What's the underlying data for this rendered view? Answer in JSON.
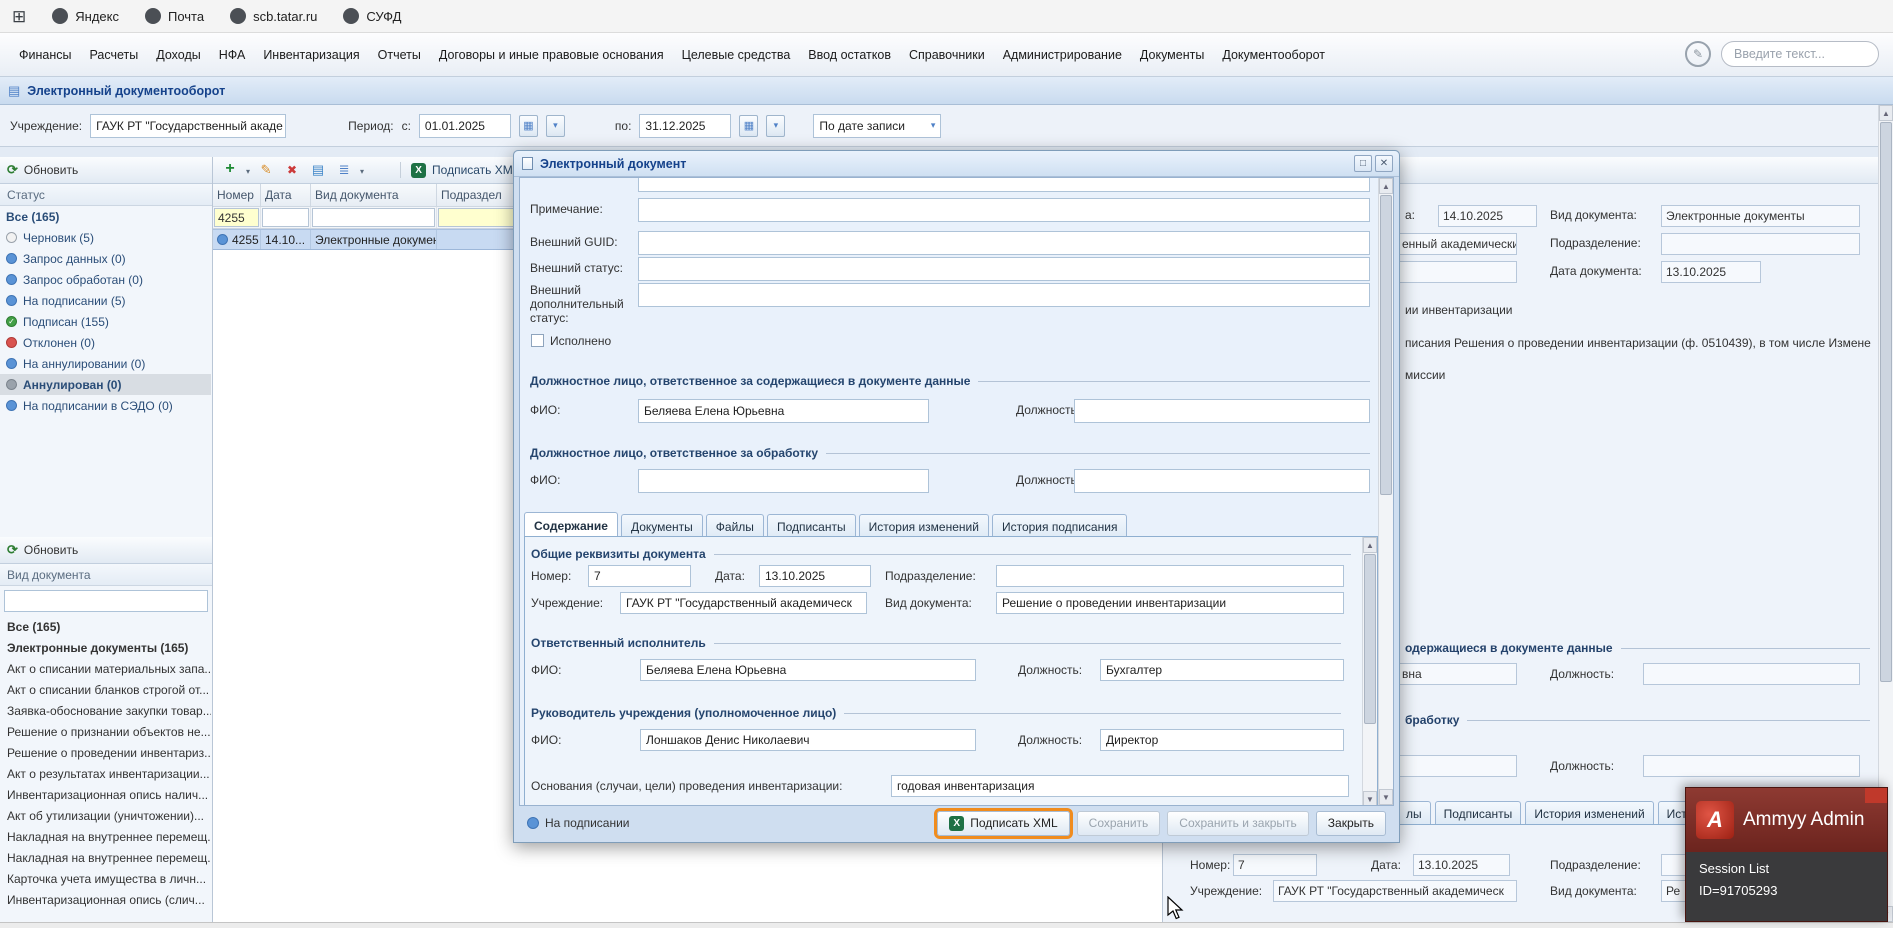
{
  "browser": {
    "bookmarks": [
      "Яндекс",
      "Почта",
      "scb.tatar.ru",
      "СУФД"
    ]
  },
  "menu": {
    "items": [
      "Финансы",
      "Расчеты",
      "Доходы",
      "НФА",
      "Инвентаризация",
      "Отчеты",
      "Договоры и иные правовые основания",
      "Целевые средства",
      "Ввод остатков",
      "Справочники",
      "Администрирование",
      "Документы",
      "Документооборот"
    ],
    "search_placeholder": "Введите текст..."
  },
  "page": {
    "title": "Электронный документооборот"
  },
  "filter_bar": {
    "institution_label": "Учреждение:",
    "institution_value": "ГАУК РТ \"Государственный акаде",
    "period_label": "Период:",
    "from_label": "с:",
    "from_value": "01.01.2025",
    "to_label": "по:",
    "to_value": "31.12.2025",
    "mode_value": "По дате записи"
  },
  "status_panel": {
    "refresh_label": "Обновить",
    "header": "Статус",
    "items": [
      {
        "label": "Все (165)",
        "cls": "b no-ic"
      },
      {
        "label": "Черновик (5)",
        "cls": "ic-draft"
      },
      {
        "label": "Запрос данных (0)",
        "cls": "ic-blue"
      },
      {
        "label": "Запрос обработан (0)",
        "cls": "ic-blue"
      },
      {
        "label": "На подписании (5)",
        "cls": "ic-blue"
      },
      {
        "label": "Подписан (155)",
        "cls": "ic-green"
      },
      {
        "label": "Отклонен (0)",
        "cls": "ic-red"
      },
      {
        "label": "На аннулировании (0)",
        "cls": "ic-blue"
      },
      {
        "label": "Аннулирован (0)",
        "cls": "b ic-gray sel"
      },
      {
        "label": "На подписании в СЭДО (0)",
        "cls": "ic-blue"
      }
    ]
  },
  "doctype_panel": {
    "refresh_label": "Обновить",
    "header": "Вид документа",
    "filter_value": "",
    "items": [
      {
        "label": "Все (165)",
        "cls": "b"
      },
      {
        "label": "Электронные документы (165)",
        "cls": "b"
      },
      {
        "label": "Акт о списании материальных запа...",
        "cls": ""
      },
      {
        "label": "Акт о списании бланков строгой от...",
        "cls": ""
      },
      {
        "label": "Заявка-обоснование закупки товар...",
        "cls": ""
      },
      {
        "label": "Решение о признании объектов не...",
        "cls": ""
      },
      {
        "label": "Решение о проведении инвентариз...",
        "cls": ""
      },
      {
        "label": "Акт о результатах инвентаризации...",
        "cls": ""
      },
      {
        "label": "Инвентаризационная опись налич...",
        "cls": ""
      },
      {
        "label": "Акт об утилизации (уничтожении)...",
        "cls": ""
      },
      {
        "label": "Накладная на внутреннее перемещ...",
        "cls": ""
      },
      {
        "label": "Накладная на внутреннее перемещ...",
        "cls": ""
      },
      {
        "label": "Карточка учета имущества в личн...",
        "cls": ""
      },
      {
        "label": "Инвентаризационная опись (слич...",
        "cls": ""
      }
    ]
  },
  "grid": {
    "toolbar": {
      "icons": [
        "add",
        "edit",
        "delete",
        "copy",
        "more",
        "refresh",
        "excel"
      ],
      "sign_xml_label": "Подписать XML"
    },
    "columns": [
      "Номер",
      "Дата",
      "Вид документа",
      "Подраздел"
    ],
    "filter_number": "4255",
    "row": {
      "number": "4255",
      "date": "14.10...",
      "doctype": "Электронные документы"
    }
  },
  "modal": {
    "title": "Электронный документ",
    "note_label": "Примечание:",
    "guid_label": "Внешний GUID:",
    "ext_status_label": "Внешний статус:",
    "ext_add_status_label": "Внешний дополнительный статус:",
    "done_label": "Исполнено",
    "resp_data_header": "Должностное лицо, ответственное за содержащиеся в документе данные",
    "resp_data_fio_label": "ФИО:",
    "resp_data_fio_value": "Беляева Елена Юрьевна",
    "resp_data_post_label": "Должность:",
    "resp_data_post_value": "",
    "resp_proc_header": "Должностное лицо, ответственное за обработку",
    "resp_proc_fio_label": "ФИО:",
    "resp_proc_fio_value": "",
    "resp_proc_post_label": "Должность:",
    "resp_proc_post_value": "",
    "tabs": [
      {
        "label": "Содержание",
        "cls": "active"
      },
      {
        "label": "Документы",
        "cls": ""
      },
      {
        "label": "Файлы",
        "cls": ""
      },
      {
        "label": "Подписанты",
        "cls": ""
      },
      {
        "label": "История изменений",
        "cls": ""
      },
      {
        "label": "История подписания",
        "cls": ""
      }
    ],
    "content": {
      "common_header": "Общие реквизиты документа",
      "number_label": "Номер:",
      "number_value": "7",
      "date_label": "Дата:",
      "date_value": "13.10.2025",
      "division_label": "Подразделение:",
      "division_value": "",
      "institution_label": "Учреждение:",
      "institution_value": "ГАУК РТ \"Государственный академическ",
      "doctype_label": "Вид документа:",
      "doctype_value": "Решение о проведении инвентаризации",
      "executor_header": "Ответственный исполнитель",
      "executor_fio_label": "ФИО:",
      "executor_fio_value": "Беляева Елена Юрьевна",
      "executor_post_label": "Должность:",
      "executor_post_value": "Бухгалтер",
      "head_header": "Руководитель учреждения (уполномоченное лицо)",
      "head_fio_label": "ФИО:",
      "head_fio_value": "Лоншаков Денис Николаевич",
      "head_post_label": "Должность:",
      "head_post_value": "Директор",
      "basis_label": "Основания (случаи, цели) проведения инвентаризации:",
      "basis_value": "годовая инвентаризация"
    },
    "footer": {
      "status": "На подписании",
      "sign_xml": "Подписать XML",
      "save": "Сохранить",
      "save_close": "Сохранить и закрыть",
      "close": "Закрыть"
    }
  },
  "preview": {
    "r1_date_label": "а:",
    "r1_date_value": "14.10.2025",
    "r1_doctype_label": "Вид документа:",
    "r1_doctype_value": "Электронные документы",
    "r2_inst_value": "енный академический",
    "r2_div_label": "Подразделение:",
    "r3_docdate_label": "Дата документа:",
    "r3_docdate_value": "13.10.2025",
    "t1": "ии инвентаризации",
    "t2": "писания Решения о проведении инвентаризации (ф. 0510439), в том числе Измене",
    "t3": "миссии",
    "sec1": "одержащиеся в документе данные",
    "fio1_value": "вна",
    "post1_label": "Должность:",
    "sec2": "бработку",
    "post2_label": "Должность:",
    "tabs": [
      {
        "label": "лы"
      },
      {
        "label": "Подписанты"
      },
      {
        "label": "История изменений"
      },
      {
        "label": "Ист"
      }
    ],
    "num_label": "Номер:",
    "num_value": "7",
    "date_label": "Дата:",
    "date_value": "13.10.2025",
    "div_label": "Подразделение:",
    "inst_label": "Учреждение:",
    "inst_value": "ГАУК РТ \"Государственный академическ",
    "doctype_label": "Вид документа:",
    "doctype_value": "Ре"
  },
  "ammyy": {
    "title": "Ammyy Admin",
    "session_list": "Session List",
    "id_line": "ID=91705293"
  }
}
